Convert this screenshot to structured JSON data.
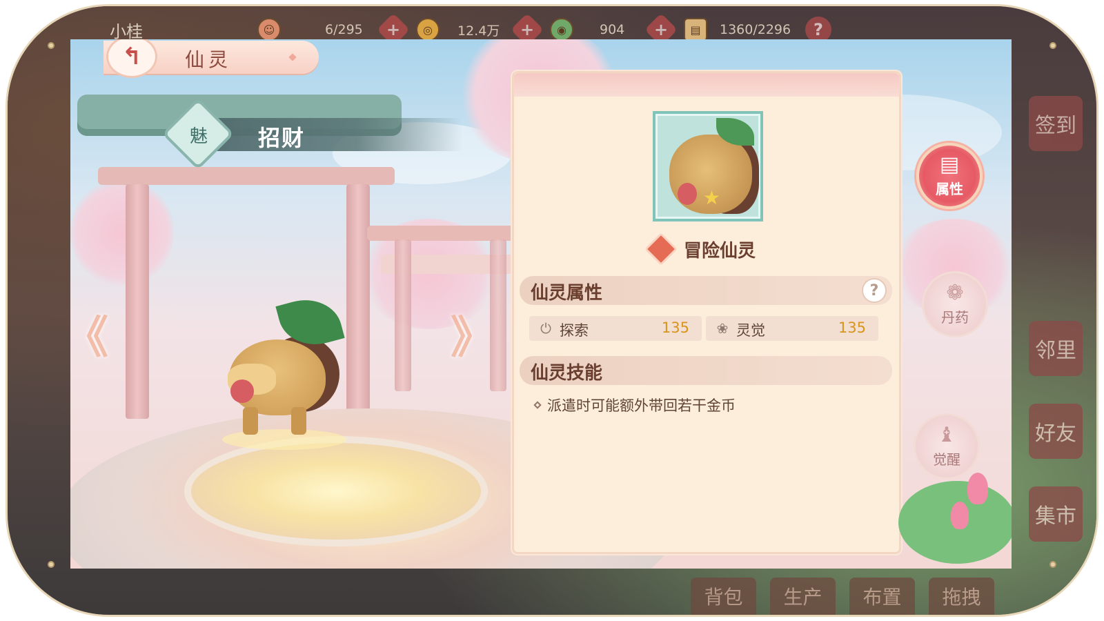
{
  "topbar": {
    "player_name": "小桂",
    "resources": [
      {
        "icon": "character-icon",
        "value": "6/295"
      },
      {
        "icon": "copper-coin-icon",
        "value": "12.4万"
      },
      {
        "icon": "jade-coin-icon",
        "value": "904"
      },
      {
        "icon": "scroll-icon",
        "value": "1360/2296"
      }
    ],
    "plus_label": "+",
    "help_label": "?"
  },
  "header": {
    "back_icon": "back-arrow-icon",
    "title": "仙灵"
  },
  "pet": {
    "badge": "魅",
    "name": "招财"
  },
  "navigation": {
    "prev": "《",
    "next": "》"
  },
  "panel": {
    "type_label": "冒险仙灵",
    "attributes_title": "仙灵属性",
    "help_label": "?",
    "stats": [
      {
        "icon": "explore-icon",
        "label": "探索",
        "value": "135"
      },
      {
        "icon": "spirit-sense-icon",
        "label": "灵觉",
        "value": "135"
      }
    ],
    "skills_title": "仙灵技能",
    "skills": [
      "派遣时可能额外带回若干金币"
    ]
  },
  "side_buttons": [
    {
      "label": "属性",
      "icon": "attributes-icon",
      "active": true
    },
    {
      "label": "丹药",
      "icon": "pill-icon",
      "active": false
    },
    {
      "label": "觉醒",
      "icon": "awaken-icon",
      "active": false
    }
  ],
  "background": {
    "right_tabs": [
      "签到",
      "邻里",
      "好友",
      "集市"
    ],
    "bottom_tabs": [
      "背包",
      "生产",
      "布置",
      "拖拽"
    ]
  },
  "colors": {
    "accent": "#e65a65",
    "stat_value": "#d8941b",
    "panel_bg": "#fdeedc",
    "ribbon": "#5a7676"
  }
}
